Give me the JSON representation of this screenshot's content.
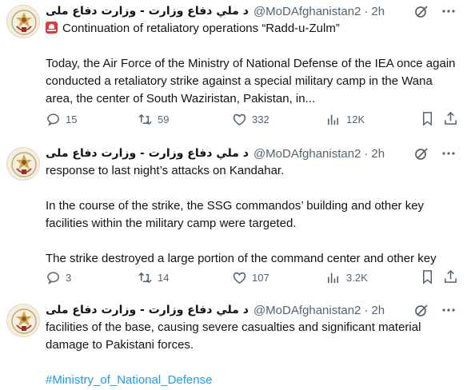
{
  "tweets": [
    {
      "name": "د ملي دفاع وزارت - وزارت دفاع ملی",
      "handle": "@MoDAfghanistan2",
      "separator": "·",
      "time": "2h",
      "line1": "Continuation of retaliatory operations “Radd-u-Zulm”",
      "paragraph": "Today, the Air Force of the Ministry of National Defense of the IEA once again conducted a retaliatory strike against a special military camp in the Wana area, the center of South Waziristan, Pakistan, in...",
      "replies": "15",
      "reposts": "59",
      "likes": "332",
      "views": "12K"
    },
    {
      "name": "د ملي دفاع وزارت - وزارت دفاع ملی",
      "handle": "@MoDAfghanistan2",
      "separator": "·",
      "time": "2h",
      "line1": "response to last night’s attacks on Kandahar.",
      "paragraph1": "In the course of the strike, the SSG commandos’ building and other key facilities within the military camp were targeted.",
      "paragraph2": "The strike destroyed a large portion of the command center and other key",
      "replies": "3",
      "reposts": "14",
      "likes": "107",
      "views": "3.2K"
    },
    {
      "name": "د ملي دفاع وزارت - وزارت دفاع ملی",
      "handle": "@MoDAfghanistan2",
      "separator": "·",
      "time": "2h",
      "paragraph": "facilities of the base, causing severe casualties and significant material damage to Pakistani forces.",
      "hashtag": "#Ministry_of_National_Defense"
    }
  ],
  "icons": {
    "grok": "grok-icon",
    "more": "more-icon",
    "reply": "reply-icon",
    "repost": "repost-icon",
    "like": "like-icon",
    "views": "views-icon",
    "bookmark": "bookmark-icon",
    "share": "share-icon"
  },
  "colors": {
    "link": "#1d9bf0",
    "secondary_text": "#536471",
    "alert_emoji": "#e8343a"
  }
}
